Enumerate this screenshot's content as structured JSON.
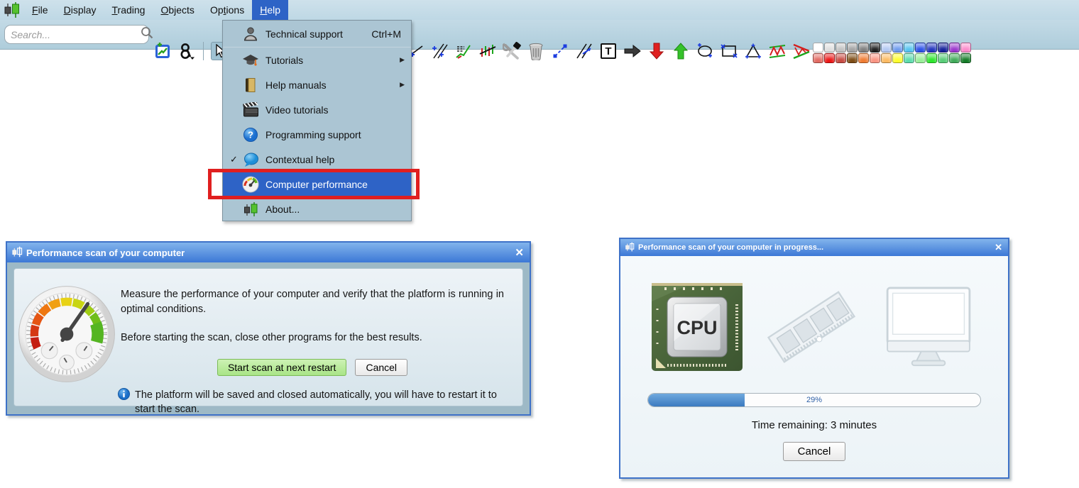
{
  "menubar": {
    "items": [
      {
        "pre": "",
        "key": "F",
        "post": "ile"
      },
      {
        "pre": "",
        "key": "D",
        "post": "isplay"
      },
      {
        "pre": "",
        "key": "T",
        "post": "rading"
      },
      {
        "pre": "",
        "key": "O",
        "post": "bjects"
      },
      {
        "pre": "Op",
        "key": "t",
        "post": "ions"
      },
      {
        "pre": "",
        "key": "H",
        "post": "elp"
      }
    ],
    "active_item": "Help"
  },
  "toolbar": {
    "search_placeholder": "Search...",
    "text_tool_glyph": "T",
    "icons": [
      "search-icon",
      "new-chart-icon",
      "linked-windows-icon",
      "cursor-icon",
      "trendline-icon",
      "multi-trendline-icon",
      "annotated-chart-icon",
      "line-on-candles-icon",
      "tools-icon",
      "trash-icon",
      "segment-icon",
      "parallel-lines-icon",
      "text-tool-icon",
      "right-arrow-icon",
      "down-arrow-icon",
      "up-arrow-icon",
      "ellipse-tool-icon",
      "rectangle-tool-icon",
      "triangle-tool-icon",
      "zigzag-pattern-icon",
      "wedge-pattern-icon",
      "color-palette"
    ],
    "palette_row1": [
      "#FFFFFF",
      "#DEDEDE",
      "#C2C2C2",
      "#A3A3A3",
      "#7E7E7E",
      "#1F1F1F",
      "#B3C8F2",
      "#6E9BEE",
      "#55C4F0",
      "#2B50E8",
      "#2334BE",
      "#15209A",
      "#9A35CC",
      "#FB8ACB"
    ],
    "palette_row2": [
      "#E26A62",
      "#EC1313",
      "#C74A42",
      "#7C4B13",
      "#EF7B31",
      "#F99381",
      "#FBBA62",
      "#FDFD2B",
      "#5BDCAC",
      "#98EE98",
      "#2BE52B",
      "#57CC76",
      "#3FAA58",
      "#137B26"
    ]
  },
  "help_menu": {
    "check_glyph": "✓",
    "submenu_arrow": "▶",
    "items": [
      {
        "label": "Technical support",
        "shortcut": "Ctrl+M"
      },
      {
        "label": "Tutorials",
        "submenu": true
      },
      {
        "label": "Help manuals",
        "submenu": true
      },
      {
        "label": "Video tutorials"
      },
      {
        "label": "Programming support"
      },
      {
        "label": "Contextual help",
        "checked": true
      },
      {
        "label": "Computer performance",
        "selected": true,
        "annotated": true
      },
      {
        "label": "About..."
      }
    ]
  },
  "scan_dialog": {
    "title": "Performance scan of your computer",
    "close_glyph": "✕",
    "body_line1": "Measure the performance of your computer and verify that the platform is running in optimal conditions.",
    "body_line2": "Before starting the scan, close other programs for the best results.",
    "start_button": "Start scan at next restart",
    "cancel_button": "Cancel",
    "info_note": "The platform will be saved and closed automatically, you will have to restart it to start the scan."
  },
  "progress_dialog": {
    "title": "Performance scan of your computer in progress...",
    "close_glyph": "✕",
    "cpu_label": "CPU",
    "progress_label": "29%",
    "progress_value": 29,
    "time_remaining": "Time remaining: 3 minutes",
    "cancel_button": "Cancel"
  },
  "colors": {
    "selection_blue": "#2E63C6",
    "annotation_red": "#E01F1F",
    "titlebar_top": "#82B4EC",
    "titlebar_bottom": "#3C78D6",
    "progress_fill": "#3B7AC0",
    "start_button_bg": "#A9E487",
    "menubar_bg": "#C3DAE6",
    "dropdown_bg": "#ABC5D3"
  }
}
